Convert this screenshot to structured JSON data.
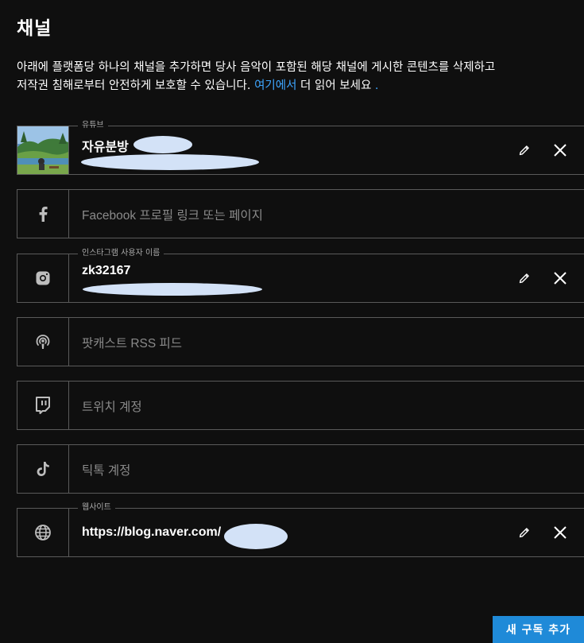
{
  "header": {
    "title": "채널"
  },
  "description": {
    "line1": "아래에 플랫폼당 하나의 채널을 추가하면 당사 음악이 포함된 해당 채널에 게시한 콘텐츠를 삭제하고",
    "line2_before": "저작권 침해로부터 안전하게 보호할 수 있습니다. ",
    "link": "여기에서",
    "line2_after": " 더 읽어 보세요",
    "dot": " ."
  },
  "channels": {
    "youtube": {
      "legend": "유튜브",
      "name": "자유분방",
      "icon": "youtube-thumbnail"
    },
    "facebook": {
      "placeholder": "Facebook 프로필 링크 또는 페이지",
      "icon": "facebook-icon"
    },
    "instagram": {
      "legend": "인스타그램 사용자 이름",
      "username": "zk32167",
      "icon": "instagram-icon"
    },
    "podcast": {
      "placeholder": "팟캐스트 RSS 피드",
      "icon": "podcast-icon"
    },
    "twitch": {
      "placeholder": "트위치 계정",
      "icon": "twitch-icon"
    },
    "tiktok": {
      "placeholder": "틱톡 계정",
      "icon": "tiktok-icon"
    },
    "website": {
      "legend": "웹사이트",
      "url": "https://blog.naver.com/",
      "icon": "globe-icon"
    }
  },
  "footer": {
    "subscribe_label": "새 구독 추가"
  },
  "colors": {
    "background": "#0f0f0f",
    "border": "#5a5a5a",
    "link": "#3ea6ff",
    "button": "#1f8ad8",
    "redaction": "#d3e2f7"
  }
}
